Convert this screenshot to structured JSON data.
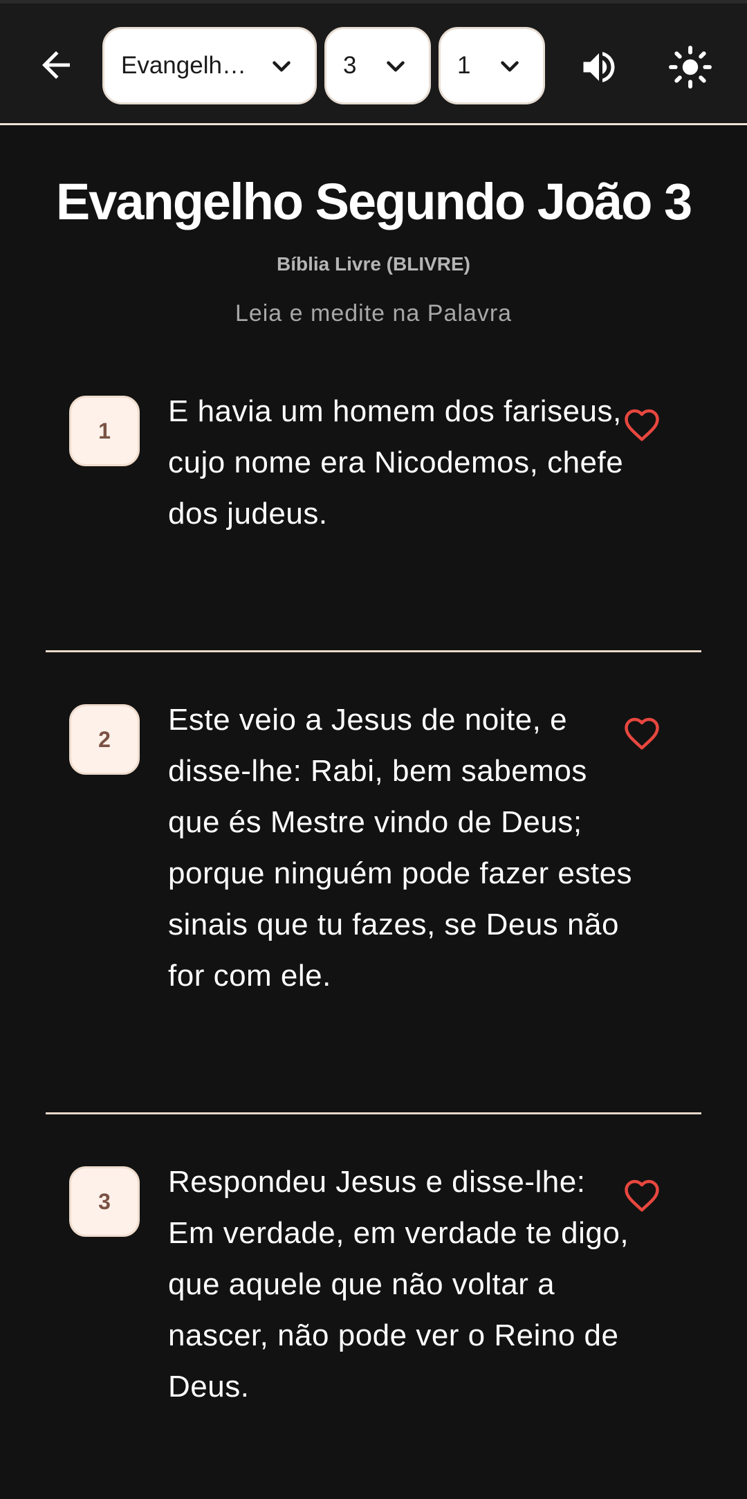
{
  "toolbar": {
    "book_selected": "Evangelho S...",
    "chapter_selected": "3",
    "verse_selected": "1",
    "back_icon": "arrow-left-icon",
    "volume_icon": "volume-icon",
    "theme_icon": "sun-icon"
  },
  "header": {
    "title": "Evangelho Segundo João 3",
    "version": "Bíblia Livre (BLIVRE)",
    "subtitle": "Leia e medite na Palavra"
  },
  "verses": [
    {
      "number": "1",
      "text": "E havia um homem dos fariseus, cujo nome era Nicodemos, chefe dos judeus."
    },
    {
      "number": "2",
      "text": "Este veio a Jesus de noite, e disse-lhe: Rabi, bem sabemos que és Mestre vindo de Deus; porque ninguém pode fazer estes sinais que tu fazes, se Deus não for com ele."
    },
    {
      "number": "3",
      "text": "Respondeu Jesus e disse-lhe: Em verdade, em verdade te digo, que aquele que não voltar a nascer, não pode ver o Reino de Deus."
    }
  ],
  "colors": {
    "background": "#121212",
    "accent_heart": "#e8473f",
    "badge_bg": "#fdf1ea",
    "badge_text": "#7a5244"
  }
}
